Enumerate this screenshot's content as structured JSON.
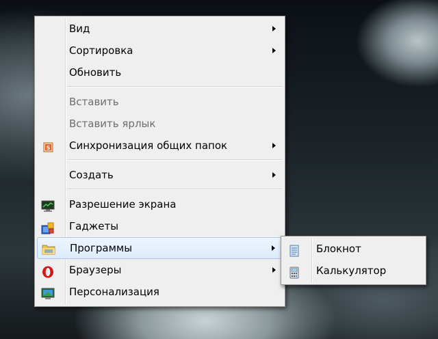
{
  "context_menu": {
    "groups": [
      [
        {
          "label": "Вид",
          "submenu": true,
          "disabled": false,
          "icon": ""
        },
        {
          "label": "Сортировка",
          "submenu": true,
          "disabled": false,
          "icon": ""
        },
        {
          "label": "Обновить",
          "submenu": false,
          "disabled": false,
          "icon": ""
        }
      ],
      [
        {
          "label": "Вставить",
          "submenu": false,
          "disabled": true,
          "icon": ""
        },
        {
          "label": "Вставить ярлык",
          "submenu": false,
          "disabled": true,
          "icon": ""
        },
        {
          "label": "Синхронизация общих папок",
          "submenu": true,
          "disabled": false,
          "icon": "sync-icon"
        }
      ],
      [
        {
          "label": "Создать",
          "submenu": true,
          "disabled": false,
          "icon": ""
        }
      ],
      [
        {
          "label": "Разрешение экрана",
          "submenu": false,
          "disabled": false,
          "icon": "monitor-icon"
        },
        {
          "label": "Гаджеты",
          "submenu": false,
          "disabled": false,
          "icon": "gadgets-icon"
        },
        {
          "label": "Программы",
          "submenu": true,
          "disabled": false,
          "icon": "folder-icon",
          "highlighted": true
        },
        {
          "label": "Браузеры",
          "submenu": true,
          "disabled": false,
          "icon": "opera-icon"
        },
        {
          "label": "Персонализация",
          "submenu": false,
          "disabled": false,
          "icon": "personalize-icon"
        }
      ]
    ]
  },
  "submenu": {
    "items": [
      {
        "label": "Блокнот",
        "icon": "notepad-icon"
      },
      {
        "label": "Калькулятор",
        "icon": "calculator-icon"
      }
    ]
  },
  "colors": {
    "menu_bg": "#efefef",
    "hover_border": "#a8c8eb",
    "disabled_text": "#6d6d6d"
  }
}
